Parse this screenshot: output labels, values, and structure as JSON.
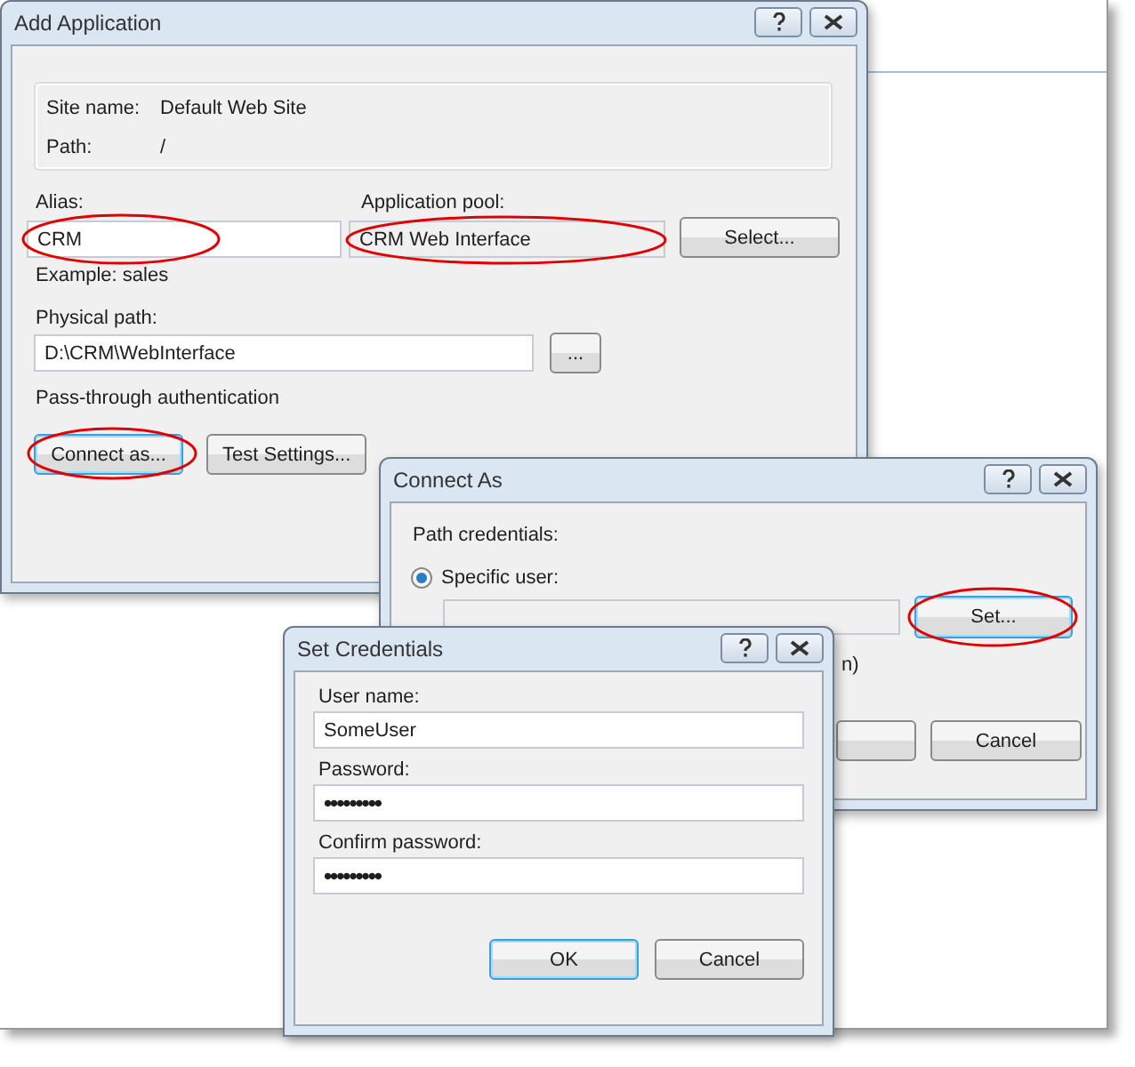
{
  "add_application": {
    "title": "Add Application",
    "site_name_label": "Site name:",
    "site_name": "Default Web Site",
    "path_label": "Path:",
    "path": "/",
    "alias": {
      "label": "Alias:",
      "value": "CRM",
      "circled": true
    },
    "application_pool": {
      "label": "Application pool:",
      "value": "CRM Web Interface",
      "circled": true
    },
    "select_button": "Select...",
    "example": "Example: sales",
    "physical_path": {
      "label": "Physical path:",
      "value": "D:\\CRM\\WebInterface"
    },
    "browse_button": "...",
    "authentication": "Pass-through authentication",
    "buttons": [
      {
        "label": "Connect as...",
        "focused": true,
        "circled": true
      },
      {
        "label": "Test Settings...",
        "focused": false,
        "circled": false
      }
    ]
  },
  "connect_as": {
    "title": "Connect As",
    "path_credentials_label": "Path credentials:",
    "options": [
      {
        "label": "Specific user:",
        "selected": true
      }
    ],
    "set_button": {
      "label": "Set...",
      "focused": true,
      "circled": true
    },
    "partial_text": "n)",
    "cancel_button": "Cancel"
  },
  "set_credentials": {
    "title": "Set Credentials",
    "fields": [
      {
        "label": "User name:",
        "value": "SomeUser",
        "kind": "text"
      },
      {
        "label": "Password:",
        "value": "•••••••••",
        "kind": "password"
      },
      {
        "label": "Confirm password:",
        "value": "•••••••••",
        "kind": "password"
      }
    ],
    "buttons": [
      {
        "label": "OK",
        "focused": true
      },
      {
        "label": "Cancel",
        "focused": false
      }
    ]
  }
}
